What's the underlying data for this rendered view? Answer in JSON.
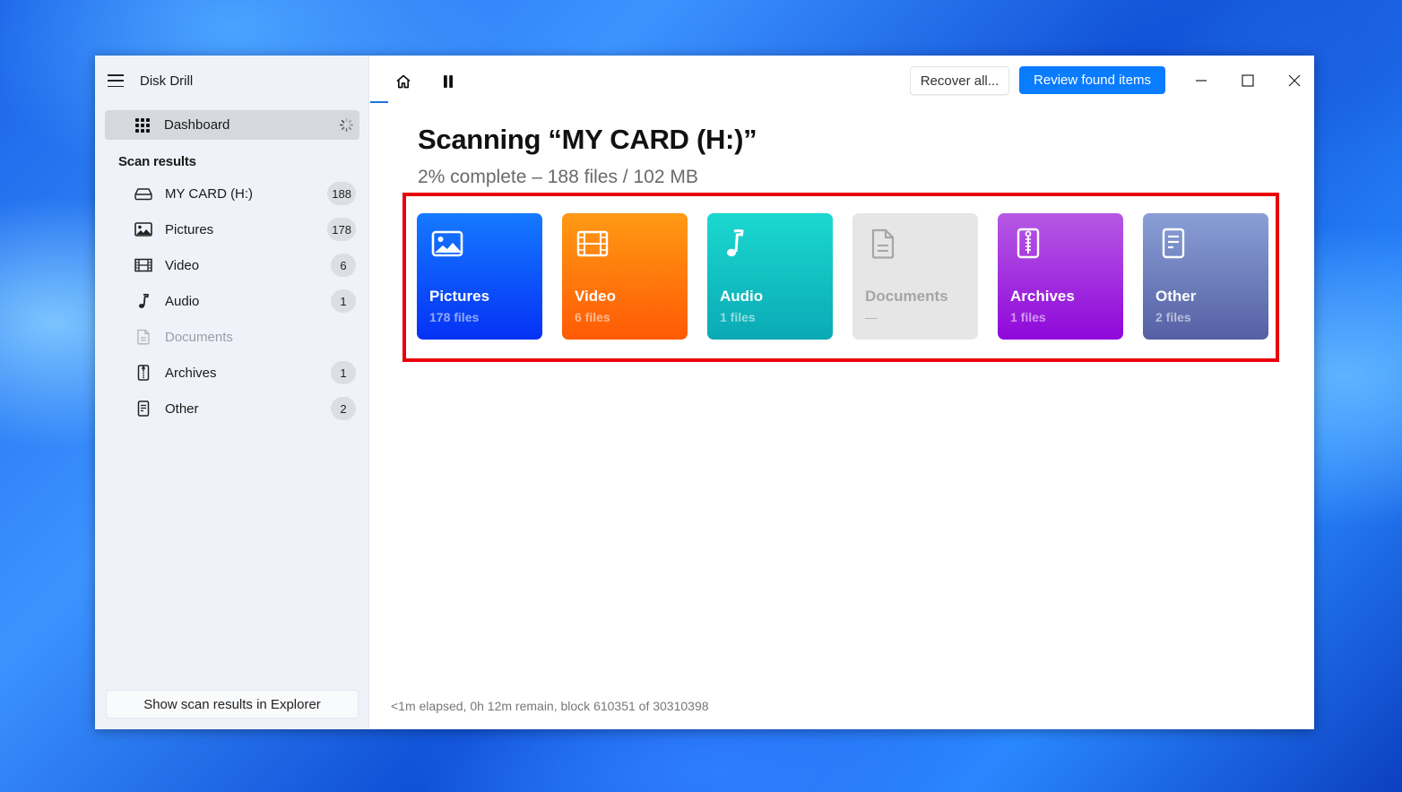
{
  "app": {
    "title": "Disk Drill"
  },
  "sidebar": {
    "dashboard_label": "Dashboard",
    "section_title": "Scan results",
    "items": [
      {
        "label": "MY CARD (H:)",
        "count": "188",
        "icon": "drive-icon",
        "enabled": true
      },
      {
        "label": "Pictures",
        "count": "178",
        "icon": "picture-icon",
        "enabled": true
      },
      {
        "label": "Video",
        "count": "6",
        "icon": "film-icon",
        "enabled": true
      },
      {
        "label": "Audio",
        "count": "1",
        "icon": "music-note-icon",
        "enabled": true
      },
      {
        "label": "Documents",
        "count": null,
        "icon": "document-icon",
        "enabled": false
      },
      {
        "label": "Archives",
        "count": "1",
        "icon": "archive-zip-icon",
        "enabled": true
      },
      {
        "label": "Other",
        "count": "2",
        "icon": "other-file-icon",
        "enabled": true
      }
    ],
    "explorer_button": "Show scan results in Explorer"
  },
  "toolbar": {
    "recover_all": "Recover all...",
    "review_found": "Review found items",
    "accent_color": "#0a7cff"
  },
  "main": {
    "heading": "Scanning “MY CARD (H:)”",
    "progress_text": "2% complete – 188 files / 102 MB",
    "progress_percent": 2,
    "cards": [
      {
        "title": "Pictures",
        "subtitle": "178 files",
        "color": "#0a5cff"
      },
      {
        "title": "Video",
        "subtitle": "6 files",
        "color": "#ff7a0a"
      },
      {
        "title": "Audio",
        "subtitle": "1 files",
        "color": "#12c4c4"
      },
      {
        "title": "Documents",
        "subtitle": "—",
        "color": "#e6e6e6"
      },
      {
        "title": "Archives",
        "subtitle": "1 files",
        "color": "#a330df"
      },
      {
        "title": "Other",
        "subtitle": "2 files",
        "color": "#6f7fc0"
      }
    ],
    "status": "<1m elapsed, 0h 12m remain, block 610351 of 30310398"
  }
}
